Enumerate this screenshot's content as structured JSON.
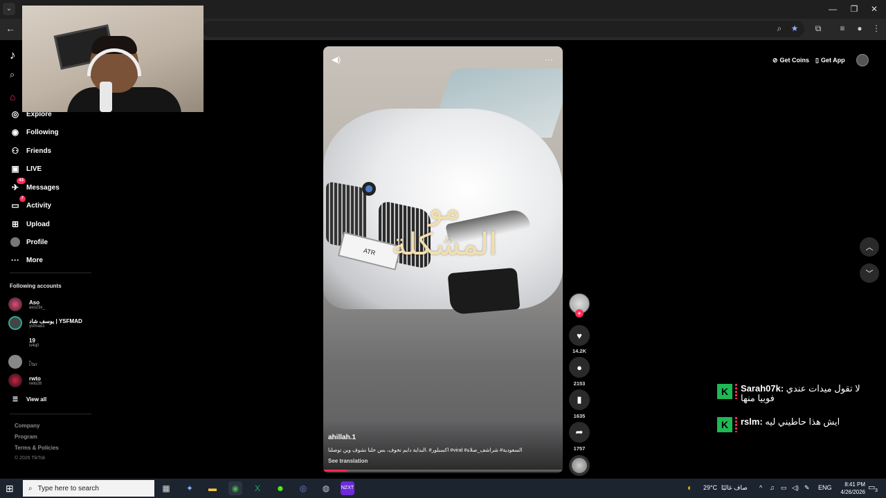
{
  "browser": {
    "tab_menu_glyph": "⌄",
    "back_glyph": "←",
    "window_controls": [
      "—",
      "❐",
      "✕"
    ],
    "toolbar_icons": [
      "zoom-icon",
      "star-icon",
      "extensions-icon",
      "media-icon",
      "profile-icon",
      "menu-icon"
    ]
  },
  "sidebar": {
    "nav": [
      {
        "label": "Explore",
        "icon": "explore-icon",
        "glyph": "◎"
      },
      {
        "label": "Following",
        "icon": "following-icon",
        "glyph": "◉"
      },
      {
        "label": "Friends",
        "icon": "friends-icon",
        "glyph": "👥"
      },
      {
        "label": "LIVE",
        "icon": "live-icon",
        "glyph": "▣"
      },
      {
        "label": "Messages",
        "icon": "messages-icon",
        "glyph": "✈",
        "badge": "43"
      },
      {
        "label": "Activity",
        "icon": "activity-icon",
        "glyph": "▭",
        "badge": "7"
      },
      {
        "label": "Upload",
        "icon": "upload-icon",
        "glyph": "⊞"
      },
      {
        "label": "Profile",
        "icon": "profile-icon",
        "glyph": "●"
      },
      {
        "label": "More",
        "icon": "more-icon",
        "glyph": "···"
      }
    ],
    "following_title": "Following accounts",
    "accounts": [
      {
        "name": "Aso",
        "handle": "aso23x_"
      },
      {
        "name": "يوسف شاد | YSFMAD",
        "handle": "ysfmad1"
      },
      {
        "name": "19",
        "handle": "iv4q0"
      },
      {
        "name": ".",
        "handle": "l7b/r"
      },
      {
        "name": "rwto",
        "handle": "rwto28"
      }
    ],
    "view_all": "View all",
    "footer": [
      "Company",
      "Program",
      "Terms & Policies"
    ],
    "copyright": "© 2026 TikTok"
  },
  "video": {
    "calligraphy": "مو المشكلة",
    "plate_text": "ATR",
    "author": "ahillah.1",
    "caption": "السعودية# شراشف_صلاة# viral# اكسبلور# .البداية دايم تخوف، بس خلنا نشوف وين توصلنا",
    "see_translation": "See translation",
    "progress": 0.1
  },
  "rail": {
    "likes": "14.2K",
    "comments": "2153",
    "saves": "1635",
    "shares": "1757"
  },
  "topbar": {
    "get_coins": "Get Coins",
    "get_app": "Get App"
  },
  "chat": [
    {
      "name": "Sarah07k:",
      "message": "لا تقول ميدات عندي فوبيا منها"
    },
    {
      "name": "rslm:",
      "message": "ايش هذا حاطيني ليه"
    }
  ],
  "taskbar": {
    "search_placeholder": "Type here to search",
    "weather": "29°C",
    "weather_desc": "صاف غالبًا",
    "lang": "ENG",
    "time": "8:41 PM",
    "date": "4/26/2026",
    "notif_count": "3"
  },
  "colors": {
    "accent": "#fe2c55",
    "chat_k": "#1db954"
  }
}
